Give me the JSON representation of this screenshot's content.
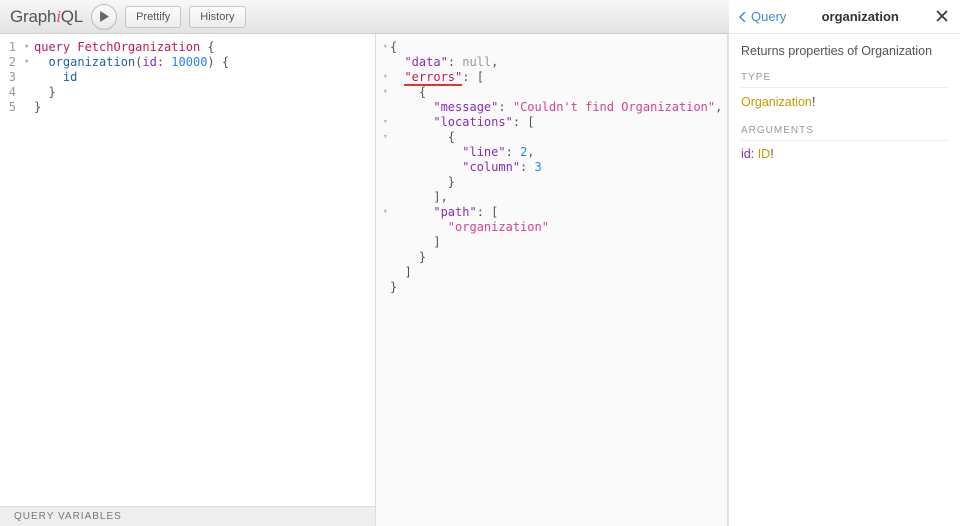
{
  "topbar": {
    "logo_prefix": "Graph",
    "logo_em": "i",
    "logo_suffix": "QL",
    "prettify": "Prettify",
    "history": "History"
  },
  "query": {
    "lines": [
      "1",
      "2",
      "3",
      "4",
      "5"
    ],
    "kw_query": "query",
    "op_name": "FetchOrganization",
    "field": "organization",
    "arg_name": "id",
    "arg_val": "10000",
    "sub_field": "id",
    "open": " {",
    "close": "}"
  },
  "qvars_label": "QUERY VARIABLES",
  "result": {
    "k_data": "\"data\"",
    "v_null": "null",
    "k_errors": "\"errors\"",
    "k_message": "\"message\"",
    "v_message": "\"Couldn't find Organization\"",
    "k_locations": "\"locations\"",
    "k_line": "\"line\"",
    "v_line": "2",
    "k_column": "\"column\"",
    "v_column": "3",
    "k_path": "\"path\"",
    "v_path0": "\"organization\""
  },
  "doc": {
    "back": "Query",
    "title": "organization",
    "desc": "Returns properties of Organization",
    "sect_type": "TYPE",
    "type_name": "Organization",
    "bang": "!",
    "sect_args": "ARGUMENTS",
    "arg_name": "id",
    "arg_sep": ": ",
    "arg_type": "ID",
    "arg_bang": "!"
  }
}
